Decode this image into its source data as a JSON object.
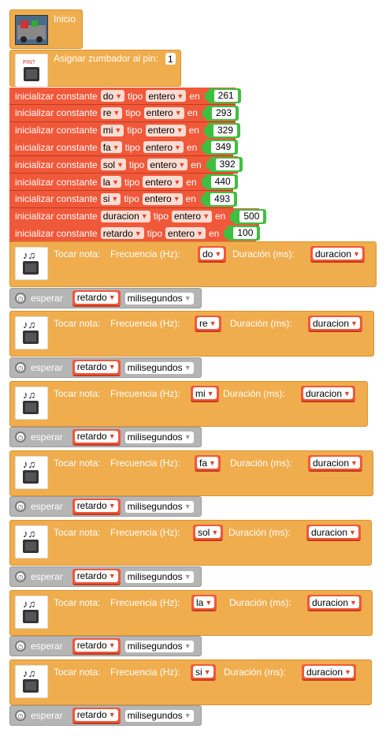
{
  "start": {
    "label": "Inicio"
  },
  "buzzer": {
    "label": "Asignar zumbador al pin:",
    "pin": "1",
    "icon_text": "PIN?"
  },
  "constants": {
    "prefix": "inicializar constante",
    "type_word": "tipo",
    "in_word": "en",
    "items": [
      {
        "name": "do",
        "type": "entero",
        "value": "261"
      },
      {
        "name": "re",
        "type": "entero",
        "value": "293"
      },
      {
        "name": "mi",
        "type": "entero",
        "value": "329"
      },
      {
        "name": "fa",
        "type": "entero",
        "value": "349"
      },
      {
        "name": "sol",
        "type": "entero",
        "value": "392"
      },
      {
        "name": "la",
        "type": "entero",
        "value": "440"
      },
      {
        "name": "si",
        "type": "entero",
        "value": "493"
      },
      {
        "name": "duracion",
        "type": "entero",
        "value": "500"
      },
      {
        "name": "retardo",
        "type": "entero",
        "value": "100"
      }
    ]
  },
  "tone": {
    "label": "Tocar nota:",
    "freq_label": "Frecuencia (Hz):",
    "dur_label": "Duración (ms):",
    "notes": [
      "do",
      "re",
      "mi",
      "fa",
      "sol",
      "la",
      "si"
    ],
    "duration_var": "duracion"
  },
  "wait": {
    "label": "esperar",
    "var": "retardo",
    "unit": "milisegundos"
  },
  "colors": {
    "orange": "#f0ad4e",
    "red": "#f0583a",
    "green": "#3fbf3f",
    "grey": "#b5b5b5"
  }
}
